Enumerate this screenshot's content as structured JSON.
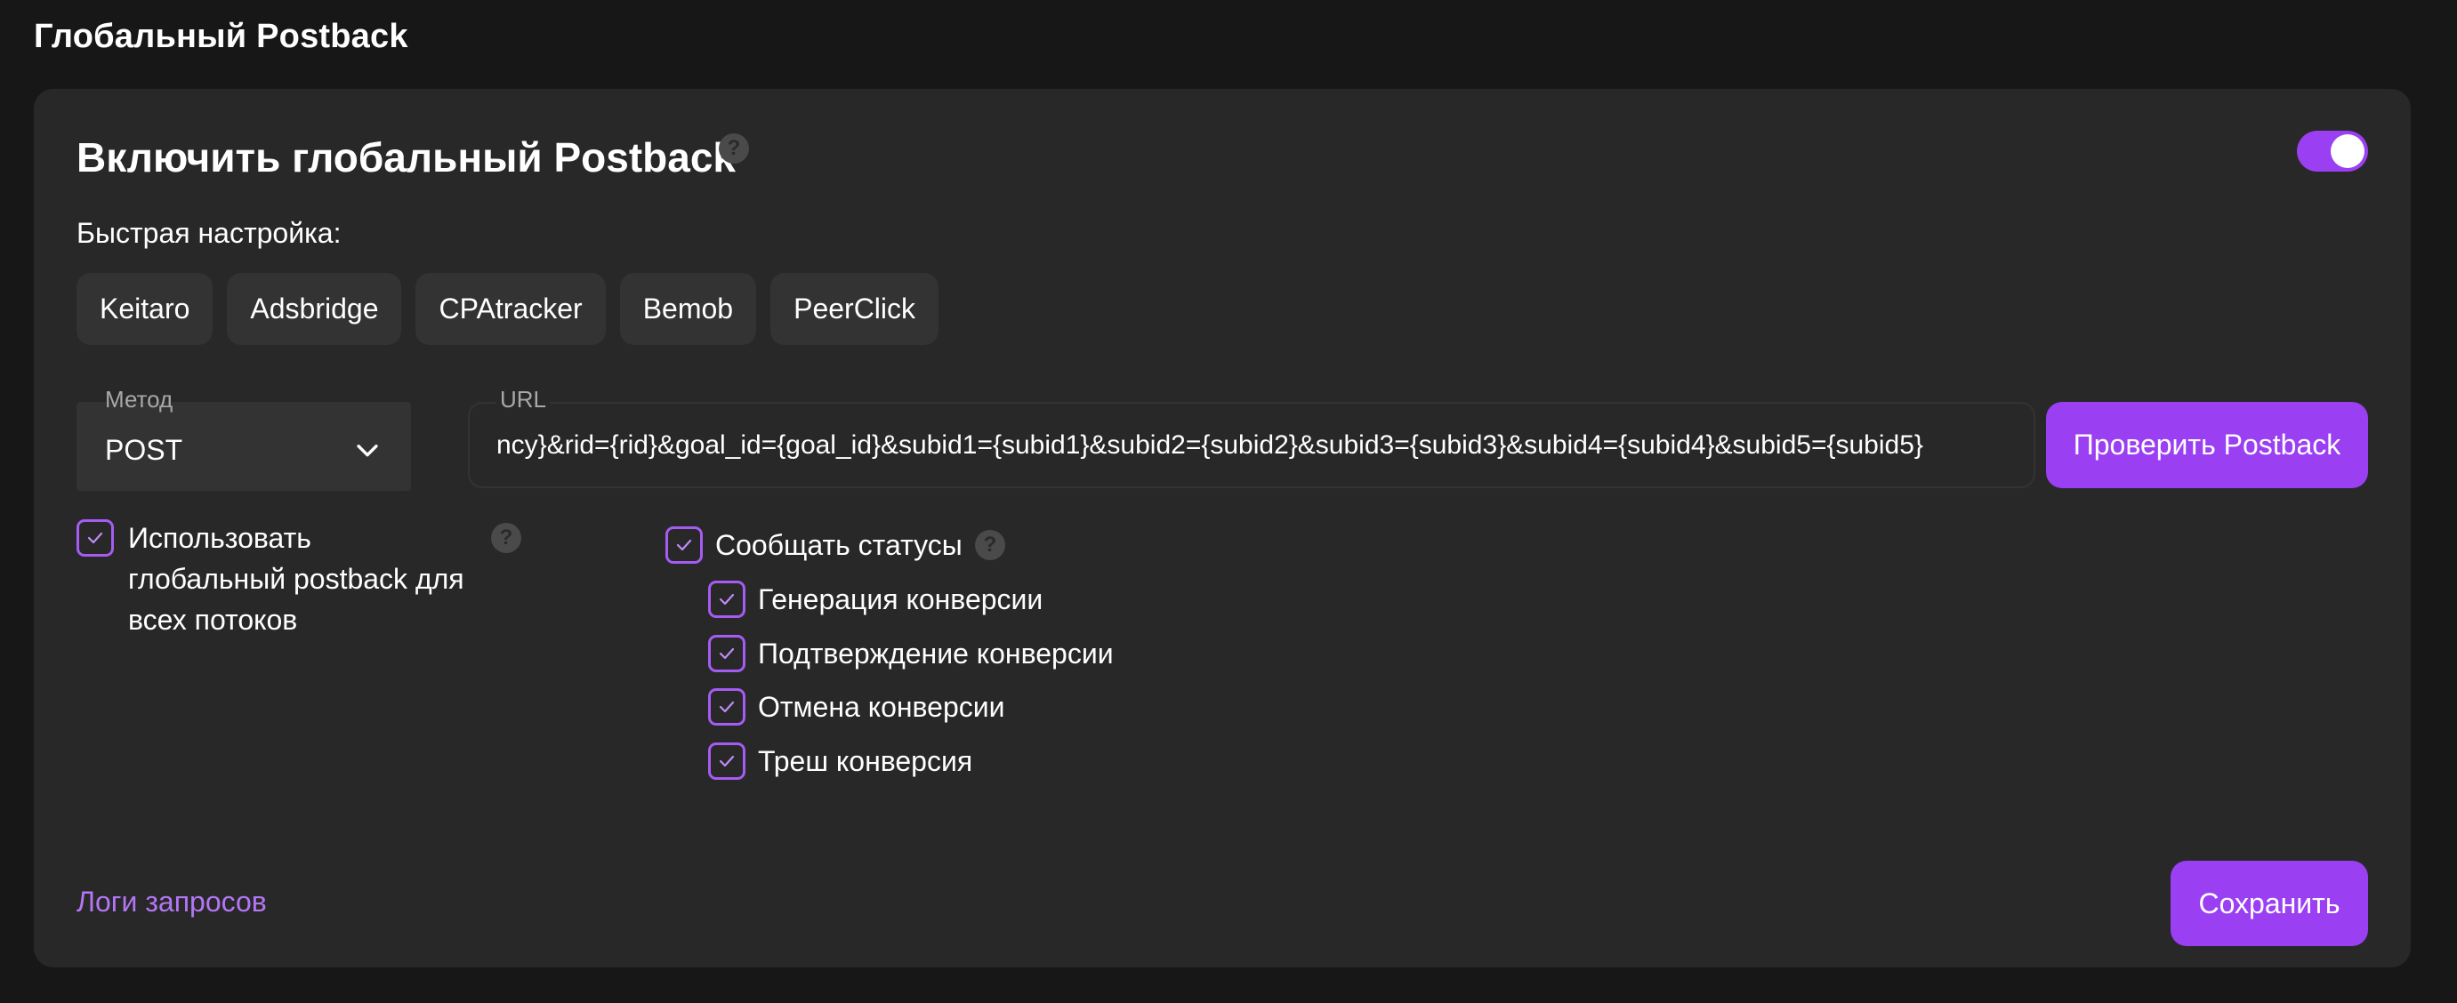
{
  "page": {
    "title": "Глобальный Postback"
  },
  "card": {
    "title": "Включить глобальный Postback",
    "help_icon": "question-icon",
    "toggle_on": true,
    "quick_setup_label": "Быстрая настройка:",
    "presets": [
      "Keitaro",
      "Adsbridge",
      "CPAtracker",
      "Bemob",
      "PeerClick"
    ],
    "method": {
      "label": "Метод",
      "value": "POST"
    },
    "url": {
      "label": "URL",
      "value": "ncy}&rid={rid}&goal_id={goal_id}&subid1={subid1}&subid2={subid2}&subid3={subid3}&subid4={subid4}&subid5={subid5}"
    },
    "check_button": "Проверить Postback",
    "use_global": {
      "checked": true,
      "label_lines": [
        "Использовать",
        "глобальный postback для",
        "всех потоков"
      ]
    },
    "report_statuses": {
      "checked": true,
      "label": "Сообщать статусы",
      "items": [
        {
          "label": "Генерация конверсии",
          "checked": true
        },
        {
          "label": "Подтверждение конверсии",
          "checked": true
        },
        {
          "label": "Отмена конверсии",
          "checked": true
        },
        {
          "label": "Треш конверсия",
          "checked": true
        }
      ]
    },
    "logs_link": "Логи запросов",
    "save_button": "Сохранить"
  },
  "colors": {
    "accent": "#9b3ff2",
    "link": "#b376f5",
    "card_bg": "#282828",
    "page_bg": "#171717"
  }
}
